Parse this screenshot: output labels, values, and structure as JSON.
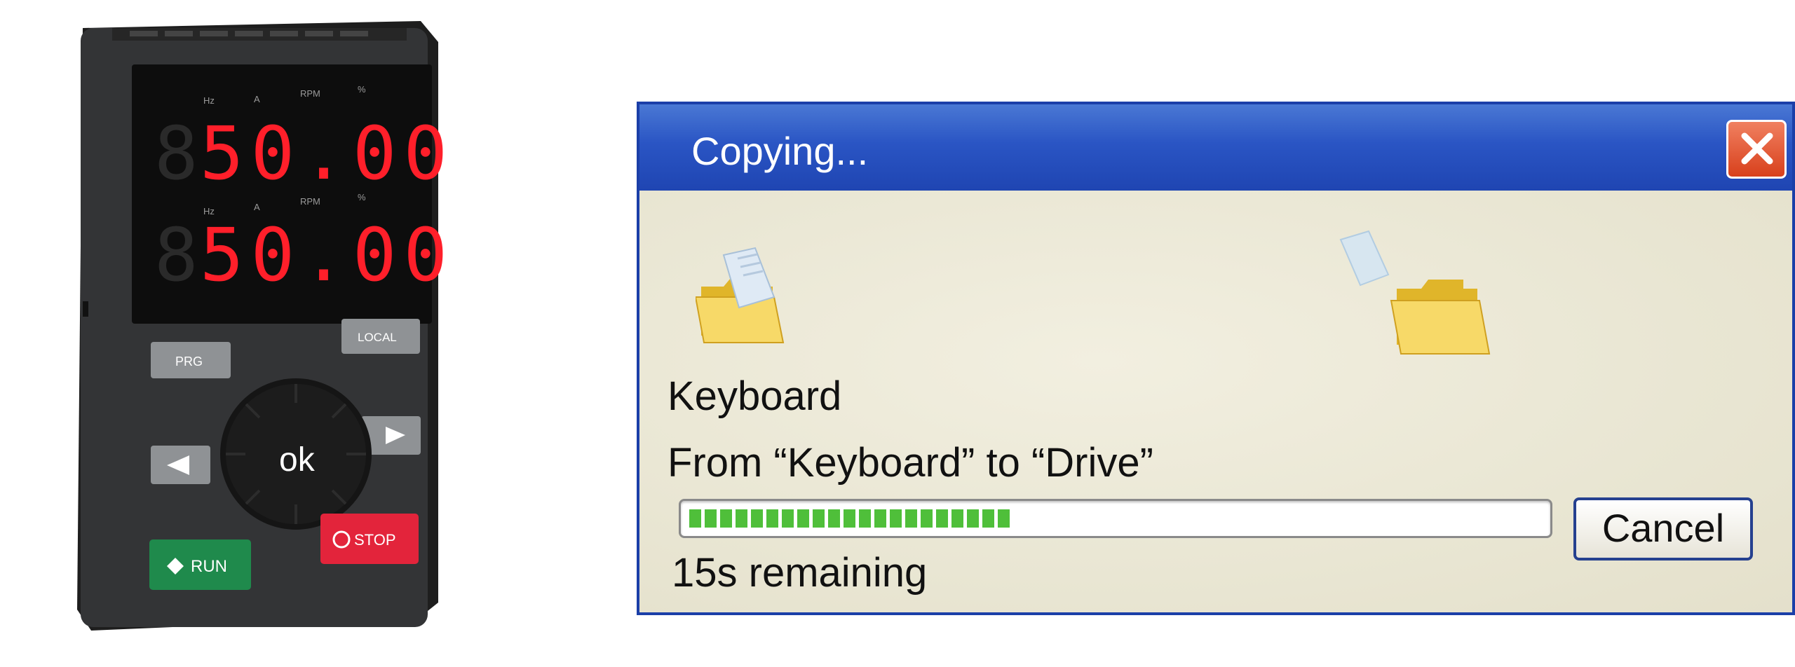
{
  "keypad": {
    "display_top": "50.00",
    "display_bottom": "50.00",
    "units_top": [
      "Hz",
      "A",
      "RPM",
      "%"
    ],
    "units_bottom": [
      "Hz",
      "A",
      "RPM",
      "%"
    ],
    "keys": {
      "prg": "PRG",
      "local_remote": "LOCAL",
      "ok": "ok",
      "run": "RUN",
      "stop": "STOP"
    },
    "colors": {
      "display": "#ff1f2a",
      "run": "#1f8a4c",
      "stop": "#e3243b",
      "body": "#333333"
    }
  },
  "dialog": {
    "title": "Copying...",
    "source_label": "Keyboard",
    "from_to": "From “Keyboard” to “Drive”",
    "progress": 0.38,
    "cancel_label": "Cancel",
    "remaining": "15s remaining",
    "icons": [
      "folder-icon",
      "document-icon",
      "close-icon"
    ],
    "colors": {
      "titlebar": "#2a55c4",
      "progress": "#4fbf3a",
      "close": "#d8401c"
    }
  }
}
